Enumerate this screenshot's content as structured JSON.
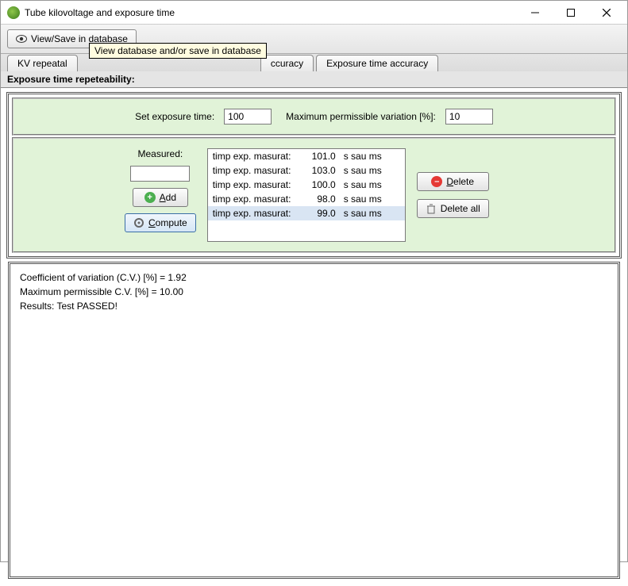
{
  "window": {
    "title": "Tube kilovoltage and exposure time"
  },
  "toolbar": {
    "view_save_label": "View/Save in database",
    "tooltip": "View database and/or save in database"
  },
  "tabs": {
    "t1": "KV repeatal",
    "t3_partial": "ccuracy",
    "t4": "Exposure time accuracy"
  },
  "subtitle": "Exposure time repeteability:",
  "inputs": {
    "set_exposure_label": "Set exposure time:",
    "set_exposure_value": "100",
    "max_var_label": "Maximum permissible variation [%]:",
    "max_var_value": "10",
    "measured_label": "Measured:"
  },
  "buttons": {
    "add": "Add",
    "compute": "Compute",
    "delete": "Delete",
    "delete_all": "Delete all"
  },
  "list": {
    "label": "timp exp. masurat:",
    "unit": "s sau ms",
    "rows": [
      {
        "v": "101.0"
      },
      {
        "v": "103.0"
      },
      {
        "v": "100.0"
      },
      {
        "v": "98.0"
      },
      {
        "v": "99.0"
      }
    ]
  },
  "results": {
    "line1": "Coefficient of variation (C.V.) [%] = 1.92",
    "line2": "Maximum permissible C.V. [%] = 10.00",
    "line3": "Results:  Test PASSED!"
  }
}
